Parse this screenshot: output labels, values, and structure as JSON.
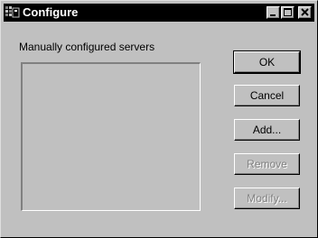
{
  "window": {
    "title": "Configure"
  },
  "main": {
    "section_label": "Manually configured servers",
    "servers": []
  },
  "buttons": {
    "ok": "OK",
    "cancel": "Cancel",
    "add": "Add...",
    "remove": "Remove",
    "modify": "Modify..."
  },
  "colors": {
    "face": "#c0c0c0",
    "titlebar": "#000000",
    "disabled_text": "#808080"
  },
  "icons": {
    "app": "window-app-icon",
    "minimize": "minimize-icon",
    "maximize": "maximize-icon",
    "close": "close-icon"
  }
}
